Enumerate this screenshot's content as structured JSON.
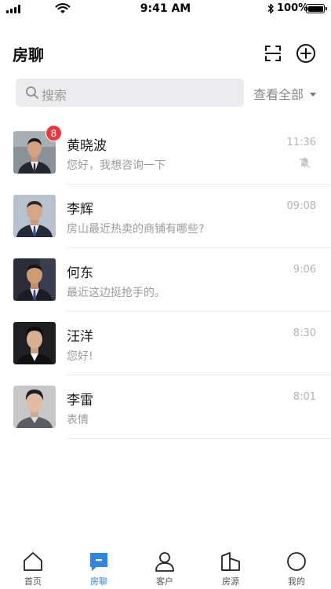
{
  "status_bar": {
    "time": "9:41 AM",
    "battery": "100%"
  },
  "header": {
    "title": "房聊",
    "scan_icon": "scan-icon",
    "add_icon": "plus-circle-icon"
  },
  "search": {
    "placeholder": "搜索",
    "filter_label": "查看全部"
  },
  "chats": [
    {
      "name": "黄晓波",
      "preview": "您好，我想咨询一下",
      "time": "11:36",
      "badge": "8",
      "muted": true
    },
    {
      "name": "李辉",
      "preview": "房山最近热卖的商铺有哪些?",
      "time": "09:08"
    },
    {
      "name": "何东",
      "preview": "最近这边挺抢手的。",
      "time": "9:06"
    },
    {
      "name": "汪洋",
      "preview": "您好!",
      "time": "8:30"
    },
    {
      "name": "李雷",
      "preview": "表情",
      "time": "8:01"
    }
  ],
  "tab_bar": {
    "active": "房聊",
    "active_color": "#2f86e0",
    "tabs": [
      {
        "label": "首页",
        "icon": "home-icon"
      },
      {
        "label": "房聊",
        "icon": "chat-icon"
      },
      {
        "label": "客户",
        "icon": "person-icon"
      },
      {
        "label": "房源",
        "icon": "building-icon"
      },
      {
        "label": "我的",
        "icon": "profile-circle-icon"
      }
    ]
  },
  "colors": {
    "badge": "#f0353d",
    "search_bg": "#ececee"
  }
}
